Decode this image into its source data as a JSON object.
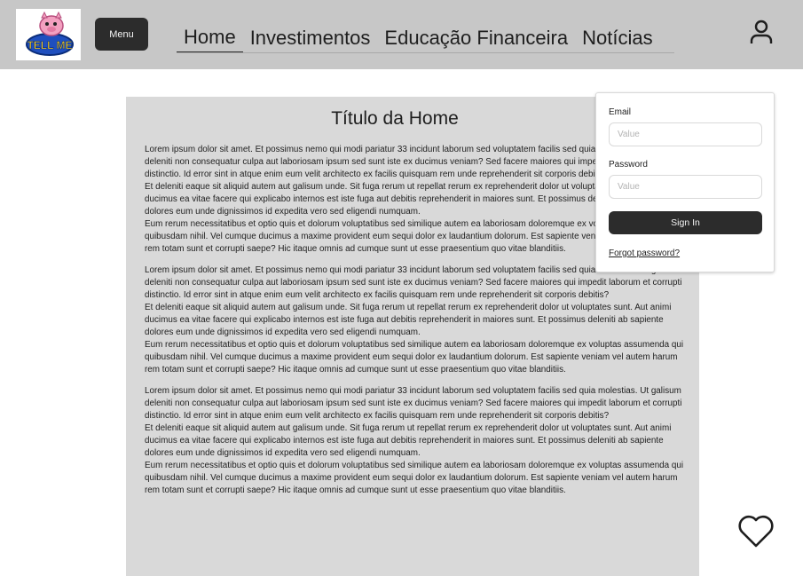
{
  "header": {
    "logo_text": "TELL ME",
    "menu_label": "Menu",
    "nav": [
      {
        "label": "Home",
        "active": true
      },
      {
        "label": "Investimentos"
      },
      {
        "label": "Educação Financeira"
      },
      {
        "label": "Notícias"
      }
    ],
    "user_icon": "user-icon"
  },
  "main": {
    "title": "Título da Home",
    "articles": [
      {
        "paragraphs": [
          "Lorem ipsum dolor sit amet. Et possimus nemo qui modi pariatur 33 incidunt laborum sed voluptatem facilis sed quia molestias. Ut galisum deleniti non consequatur culpa aut laboriosam ipsum sed sunt iste ex ducimus veniam? Sed facere maiores qui impedit laborum et corrupti distinctio. Id error sint in atque enim eum velit architecto ex facilis quisquam rem unde reprehenderit sit corporis debitis?",
          "Et deleniti eaque sit aliquid autem aut galisum unde. Sit fuga rerum ut repellat rerum ex reprehenderit dolor ut voluptates sunt. Aut animi ducimus ea vitae facere qui explicabo internos est iste fuga aut debitis reprehenderit in maiores sunt. Et possimus deleniti ab sapiente dolores eum unde dignissimos id expedita vero sed eligendi numquam.",
          "Eum rerum necessitatibus et optio quis et dolorum voluptatibus sed similique autem ea laboriosam doloremque ex voluptas assumenda qui quibusdam nihil. Vel cumque ducimus a maxime provident eum sequi dolor ex laudantium dolorum. Est sapiente veniam vel autem harum rem totam sunt et corrupti saepe? Hic itaque omnis ad cumque sunt ut esse praesentium quo vitae blanditiis."
        ]
      },
      {
        "paragraphs": [
          "Lorem ipsum dolor sit amet. Et possimus nemo qui modi pariatur 33 incidunt laborum sed voluptatem facilis sed quia molestias. Ut galisum deleniti non consequatur culpa aut laboriosam ipsum sed sunt iste ex ducimus veniam? Sed facere maiores qui impedit laborum et corrupti distinctio. Id error sint in atque enim eum velit architecto ex facilis quisquam rem unde reprehenderit sit corporis debitis?",
          "Et deleniti eaque sit aliquid autem aut galisum unde. Sit fuga rerum ut repellat rerum ex reprehenderit dolor ut voluptates sunt. Aut animi ducimus ea vitae facere qui explicabo internos est iste fuga aut debitis reprehenderit in maiores sunt. Et possimus deleniti ab sapiente dolores eum unde dignissimos id expedita vero sed eligendi numquam.",
          "Eum rerum necessitatibus et optio quis et dolorum voluptatibus sed similique autem ea laboriosam doloremque ex voluptas assumenda qui quibusdam nihil. Vel cumque ducimus a maxime provident eum sequi dolor ex laudantium dolorum. Est sapiente veniam vel autem harum rem totam sunt et corrupti saepe? Hic itaque omnis ad cumque sunt ut esse praesentium quo vitae blanditiis."
        ]
      },
      {
        "paragraphs": [
          "Lorem ipsum dolor sit amet. Et possimus nemo qui modi pariatur 33 incidunt laborum sed voluptatem facilis sed quia molestias. Ut galisum deleniti non consequatur culpa aut laboriosam ipsum sed sunt iste ex ducimus veniam? Sed facere maiores qui impedit laborum et corrupti distinctio. Id error sint in atque enim eum velit architecto ex facilis quisquam rem unde reprehenderit sit corporis debitis?",
          "Et deleniti eaque sit aliquid autem aut galisum unde. Sit fuga rerum ut repellat rerum ex reprehenderit dolor ut voluptates sunt. Aut animi ducimus ea vitae facere qui explicabo internos est iste fuga aut debitis reprehenderit in maiores sunt. Et possimus deleniti ab sapiente dolores eum unde dignissimos id expedita vero sed eligendi numquam.",
          "Eum rerum necessitatibus et optio quis et dolorum voluptatibus sed similique autem ea laboriosam doloremque ex voluptas assumenda qui quibusdam nihil. Vel cumque ducimus a maxime provident eum sequi dolor ex laudantium dolorum. Est sapiente veniam vel autem harum rem totam sunt et corrupti saepe? Hic itaque omnis ad cumque sunt ut esse praesentium quo vitae blanditiis."
        ]
      }
    ]
  },
  "signin": {
    "email_label": "Email",
    "email_placeholder": "Value",
    "password_label": "Password",
    "password_placeholder": "Value",
    "button_label": "Sign In",
    "forgot_label": "Forgot password?"
  },
  "favorite_icon": "heart-icon",
  "colors": {
    "header_bg": "#c7c7c7",
    "content_bg": "#d9d9d9",
    "button_dark": "#2c2c2c"
  }
}
